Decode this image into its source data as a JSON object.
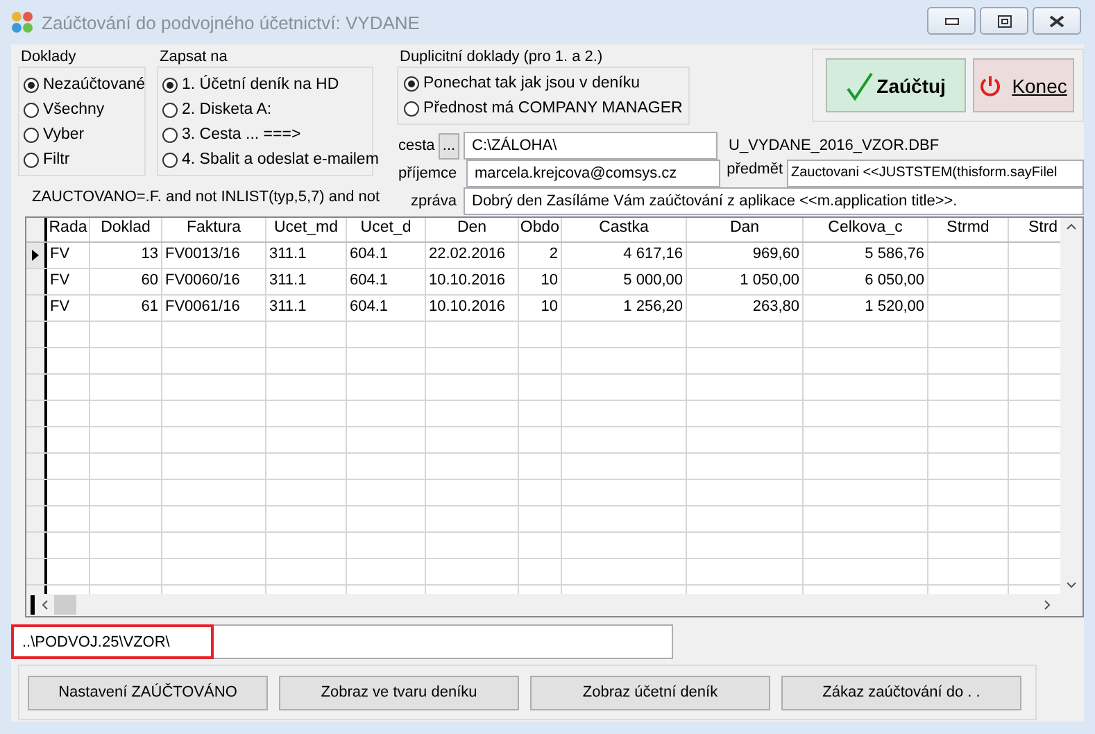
{
  "window": {
    "title": "Zaúčtování do podvojného účetnictví: VYDANE"
  },
  "doklady": {
    "label": "Doklady",
    "options": [
      {
        "label": "Nezaúčtované",
        "selected": true
      },
      {
        "label": "Všechny",
        "selected": false
      },
      {
        "label": "Vyber",
        "selected": false
      },
      {
        "label": "Filtr",
        "selected": false
      }
    ]
  },
  "zapsat_na": {
    "label": "Zapsat na",
    "options": [
      {
        "label": "1. Účetní deník na HD",
        "selected": true
      },
      {
        "label": "2. Disketa A:",
        "selected": false
      },
      {
        "label": "3. Cesta ... ===>",
        "selected": false
      },
      {
        "label": "4. Sbalit a odeslat e-mailem",
        "selected": false
      }
    ]
  },
  "duplicitni": {
    "label": "Duplicitní doklady (pro 1. a 2.)",
    "options": [
      {
        "label": "Ponechat tak jak jsou v deníku",
        "selected": true
      },
      {
        "label": "Přednost má COMPANY MANAGER",
        "selected": false
      }
    ]
  },
  "actions": {
    "post": "Zaúčtuj",
    "close": "Konec"
  },
  "filter": "ZAUCTOVANO=.F. and  not INLIST(typ,5,7) and not",
  "cesta": {
    "label": "cesta",
    "browse": "...",
    "value": "C:\\ZÁLOHA\\",
    "filename": "U_VYDANE_2016_VZOR.DBF"
  },
  "prijemce": {
    "label": "příjemce",
    "value": "marcela.krejcova@comsys.cz"
  },
  "predmet": {
    "label": "předmět",
    "value": "Zauctovani <<JUSTSTEM(thisform.sayFilel"
  },
  "zprava": {
    "label": "zpráva",
    "value": "Dobrý den  Zasíláme Vám zaúčtování z aplikace <<m.application  title>>."
  },
  "table": {
    "columns": [
      "Rada",
      "Doklad",
      "Faktura",
      "Ucet_md",
      "Ucet_d",
      "Den",
      "Obdo",
      "Castka",
      "Dan",
      "Celkova_c",
      "Strmd",
      "Strd"
    ],
    "rows": [
      {
        "selected": true,
        "cells": [
          "FV",
          "13",
          "FV0013/16",
          "311.1",
          "604.1",
          "22.02.2016",
          "2",
          "4 617,16",
          "969,60",
          "5 586,76",
          "",
          ""
        ]
      },
      {
        "selected": false,
        "cells": [
          "FV",
          "60",
          "FV0060/16",
          "311.1",
          "604.1",
          "10.10.2016",
          "10",
          "5 000,00",
          "1 050,00",
          "6 050,00",
          "",
          ""
        ]
      },
      {
        "selected": false,
        "cells": [
          "FV",
          "61",
          "FV0061/16",
          "311.1",
          "604.1",
          "10.10.2016",
          "10",
          "1 256,20",
          "263,80",
          "1 520,00",
          "",
          ""
        ]
      }
    ]
  },
  "path": "..\\PODVOJ.25\\VZOR\\",
  "buttons": [
    "Nastavení ZAÚČTOVÁNO",
    "Zobraz ve tvaru deníku",
    "Zobraz účetní deník",
    "Zákaz zaúčtování do  .  ."
  ]
}
